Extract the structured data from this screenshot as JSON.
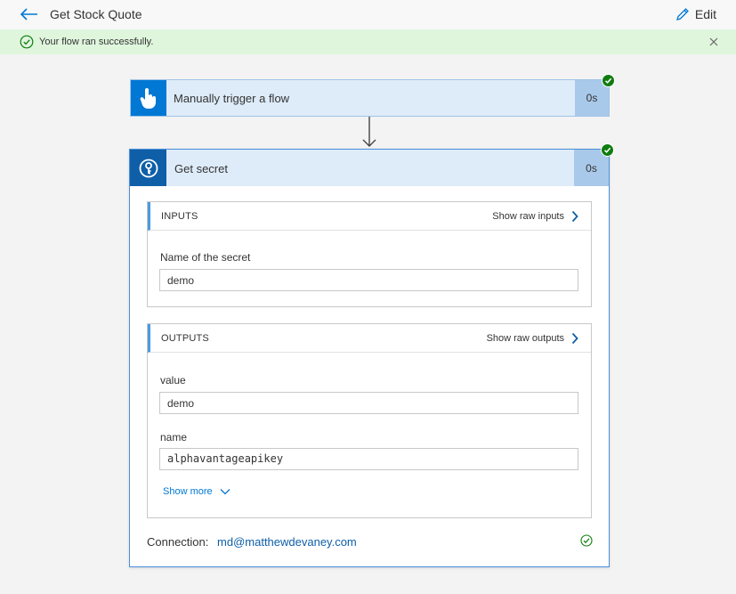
{
  "header": {
    "title": "Get Stock Quote",
    "edit_label": "Edit"
  },
  "banner": {
    "message": "Your flow ran successfully."
  },
  "trigger": {
    "title": "Manually trigger a flow",
    "duration": "0s"
  },
  "action": {
    "title": "Get secret",
    "duration": "0s",
    "inputs": {
      "label": "INPUTS",
      "raw_link": "Show raw inputs",
      "fields": [
        {
          "label": "Name of the secret",
          "value": "demo"
        }
      ]
    },
    "outputs": {
      "label": "OUTPUTS",
      "raw_link": "Show raw outputs",
      "fields": [
        {
          "label": "value",
          "value": "demo"
        },
        {
          "label": "name",
          "value": "alphavantageapikey"
        }
      ],
      "show_more": "Show more"
    },
    "connection": {
      "label": "Connection:",
      "value": "md@matthewdevaney.com"
    }
  },
  "colors": {
    "accent": "#0078d4",
    "success": "#107c10",
    "banner_bg": "#dff6dd",
    "card_header_bg": "#deecf9"
  }
}
